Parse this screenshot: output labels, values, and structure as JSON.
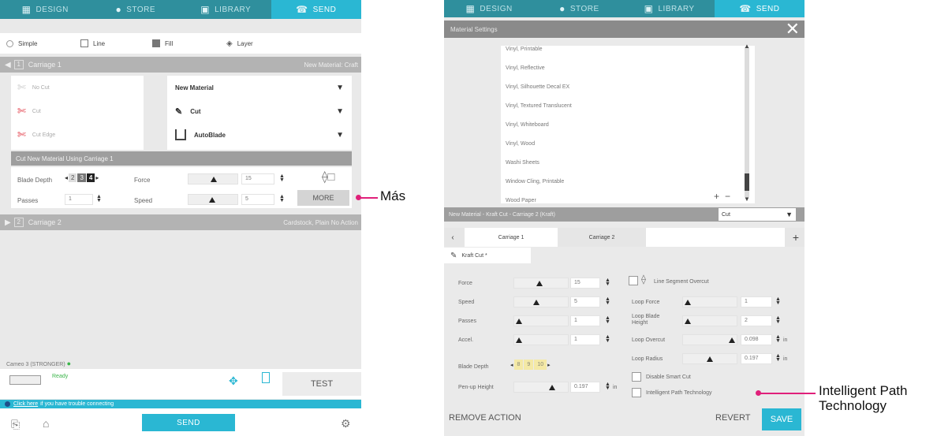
{
  "left": {
    "tabs": [
      {
        "label": "DESIGN",
        "icon": "design-icon"
      },
      {
        "label": "STORE",
        "icon": "store-icon"
      },
      {
        "label": "LIBRARY",
        "icon": "library-icon"
      },
      {
        "label": "SEND",
        "icon": "send-icon"
      }
    ],
    "modes": [
      "Simple",
      "Line",
      "Fill",
      "Layer"
    ],
    "carriage1": {
      "label": "Carriage 1",
      "number": "1",
      "material": "New Material: Craft"
    },
    "cut_options": [
      "No Cut",
      "Cut",
      "Cut Edge"
    ],
    "selectors": {
      "material": "New Material",
      "action": "Cut",
      "tool": "AutoBlade"
    },
    "using_bar": "Cut New Material Using Carriage 1",
    "params": {
      "blade_depth_label": "Blade Depth",
      "blade_depth_values": [
        "2",
        "3",
        "4"
      ],
      "force_label": "Force",
      "force_value": "15",
      "passes_label": "Passes",
      "passes_value": "1",
      "speed_label": "Speed",
      "speed_value": "5"
    },
    "more_button": "MORE",
    "carriage2": {
      "label": "Carriage 2",
      "number": "2",
      "material": "Cardstock, Plain No Action"
    },
    "device_name": "Cameo 3 (STRONGER)",
    "ready_status": "Ready",
    "test_button": "TEST",
    "help_link": "Click here",
    "help_text": "if you have trouble connecting",
    "send_button": "SEND"
  },
  "callouts": {
    "mas": "Más",
    "ipt_line1": "Intelligent Path",
    "ipt_line2": "Technology"
  },
  "right": {
    "tabs": [
      {
        "label": "DESIGN",
        "icon": "design-icon"
      },
      {
        "label": "STORE",
        "icon": "store-icon"
      },
      {
        "label": "LIBRARY",
        "icon": "library-icon"
      },
      {
        "label": "SEND",
        "icon": "send-icon"
      }
    ],
    "panel_title": "Material Settings",
    "materials": [
      "Vinyl, Printable",
      "Vinyl, Reflective",
      "Vinyl, Silhouette Decal EX",
      "Vinyl, Textured Translucent",
      "Vinyl, Whiteboard",
      "Vinyl, Wood",
      "Washi Sheets",
      "Window Cling, Printable",
      "Wood Paper"
    ],
    "material_bar": "New Material - Kraft Cut - Carriage 2 (Kraft)",
    "action_select": "Cut",
    "carriage_tabs": [
      "Carriage 1",
      "Carriage 2"
    ],
    "action_name": "Kraft Cut *",
    "fields": {
      "force": {
        "label": "Force",
        "value": "15"
      },
      "speed": {
        "label": "Speed",
        "value": "5"
      },
      "passes": {
        "label": "Passes",
        "value": "1"
      },
      "accel": {
        "label": "Accel.",
        "value": "1"
      },
      "blade_depth": {
        "label": "Blade Depth",
        "values": [
          "8",
          "9",
          "10"
        ]
      },
      "penup": {
        "label": "Pen-up Height",
        "value": "0.197",
        "unit": "in"
      }
    },
    "overcut": {
      "label": "Line Segment Overcut"
    },
    "loop_fields": {
      "loop_force": {
        "label": "Loop Force",
        "value": "1"
      },
      "loop_blade_height": {
        "label": "Loop Blade Height",
        "value": "2"
      },
      "loop_overcut": {
        "label": "Loop Overcut",
        "value": "0.098",
        "unit": "in"
      },
      "loop_radius": {
        "label": "Loop Radius",
        "value": "0.197",
        "unit": "in"
      }
    },
    "disable_smart_cut": "Disable Smart Cut",
    "intelligent_path": "Intelligent Path Technology",
    "remove_action": "REMOVE ACTION",
    "revert": "REVERT",
    "save": "SAVE"
  }
}
